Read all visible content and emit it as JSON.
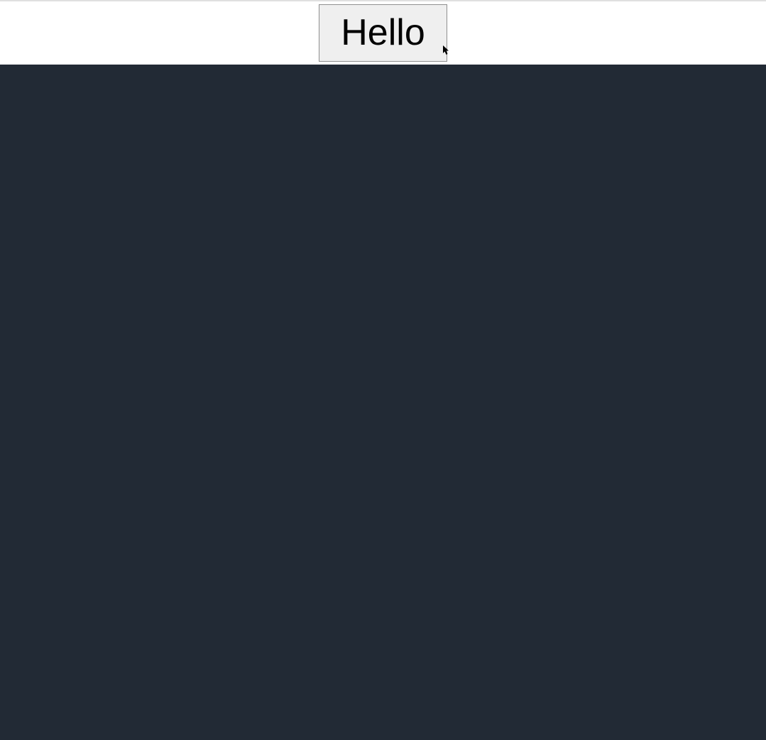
{
  "topbar": {
    "button_label": "Hello"
  },
  "colors": {
    "main_bg": "#222a35",
    "button_bg": "#efefef",
    "button_border": "#8f8f8f"
  }
}
